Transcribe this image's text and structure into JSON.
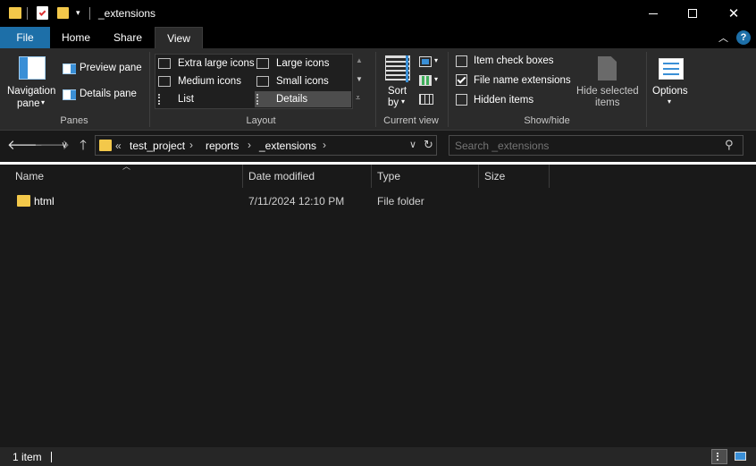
{
  "window": {
    "title": "_extensions"
  },
  "ribbon_tabs": [
    {
      "label": "File"
    },
    {
      "label": "Home"
    },
    {
      "label": "Share"
    },
    {
      "label": "View"
    }
  ],
  "panes": {
    "navigation_pane": "Navigation",
    "navigation_pane_line2": "pane",
    "preview_pane": "Preview pane",
    "details_pane": "Details pane",
    "group_label": "Panes"
  },
  "layout": {
    "items": [
      {
        "label": "Extra large icons"
      },
      {
        "label": "Large icons"
      },
      {
        "label": "Medium icons"
      },
      {
        "label": "Small icons"
      },
      {
        "label": "List"
      },
      {
        "label": "Details"
      }
    ],
    "group_label": "Layout"
  },
  "current_view": {
    "sort_label": "Sort",
    "sort_label2": "by",
    "group_label": "Current view"
  },
  "show_hide": {
    "item_check_boxes": "Item check boxes",
    "file_name_extensions": "File name extensions",
    "hidden_items": "Hidden items",
    "hide_selected": "Hide selected",
    "hide_selected2": "items",
    "group_label": "Show/hide",
    "checked": {
      "item_check_boxes": false,
      "file_name_extensions": true,
      "hidden_items": false
    }
  },
  "options": {
    "label": "Options"
  },
  "address": {
    "overflow": "«",
    "crumbs": [
      "test_project",
      "reports",
      "_extensions"
    ]
  },
  "search": {
    "placeholder": "Search _extensions"
  },
  "columns": [
    "Name",
    "Date modified",
    "Type",
    "Size"
  ],
  "files": [
    {
      "name": "html",
      "date_modified": "7/11/2024 12:10 PM",
      "type": "File folder",
      "size": ""
    }
  ],
  "status": {
    "count": "1 item"
  },
  "colors": {
    "accent": "#1d6fa8",
    "folder": "#f3c84a",
    "background": "#191919"
  }
}
